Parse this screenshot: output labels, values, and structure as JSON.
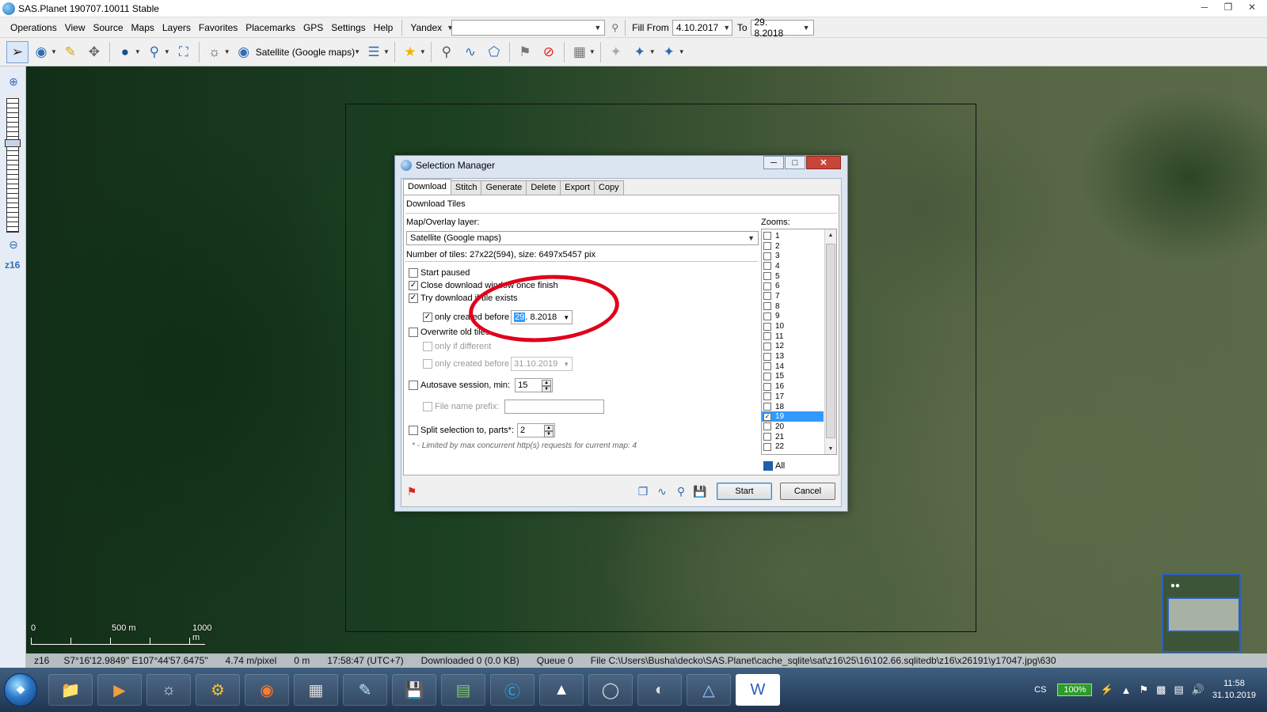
{
  "app": {
    "title": "SAS.Planet 190707.10011 Stable"
  },
  "menubar": {
    "items": [
      "Operations",
      "View",
      "Source",
      "Maps",
      "Layers",
      "Favorites",
      "Placemarks",
      "GPS",
      "Settings",
      "Help"
    ],
    "search_provider": "Yandex",
    "search_value": "",
    "fill_from_label": "Fill From",
    "fill_from_value": "4.10.2017",
    "to_label": "To",
    "to_value": "29.  8.2018"
  },
  "toolbar": {
    "map_source": "Satellite (Google maps)"
  },
  "map": {
    "zoom_label": "z16",
    "scale_labels": [
      "0",
      "500 m",
      "1000 m"
    ]
  },
  "statusbar": {
    "zoom": "z16",
    "coords": "S7°16'12.9849\" E107°44'57.6475\"",
    "resolution": "4.74 m/pixel",
    "altitude": "0 m",
    "time": "17:58:47 (UTC+7)",
    "downloaded": "Downloaded 0 (0.0 KB)",
    "queue": "Queue 0",
    "file": "File C:\\Users\\Busha\\decko\\SAS.Planet\\cache_sqlite\\sat\\z16\\25\\16\\102.66.sqlitedb\\z16\\x26191\\y17047.jpg\\630"
  },
  "dialog": {
    "title": "Selection Manager",
    "tabs": [
      "Download",
      "Stitch",
      "Generate",
      "Delete",
      "Export",
      "Copy"
    ],
    "heading": "Download Tiles",
    "layer_label": "Map/Overlay layer:",
    "layer_value": "Satellite (Google maps)",
    "tiles_info": "Number of tiles: 27x22(594), size: 6497x5457 pix",
    "start_paused": "Start paused",
    "close_window": "Close download window once finish",
    "try_download": "Try download if tile exists",
    "only_created_before": "only created before",
    "created_before_date_highlight": "29",
    "created_before_date_rest": ".  8.2018",
    "overwrite_old": "Overwrite old tiles",
    "only_if_different": "only if different",
    "only_created_before_2": "only created before",
    "created_before_date_2": "31.10.2019",
    "autosave_label": "Autosave session, min:",
    "autosave_value": "15",
    "file_prefix_label": "File name prefix:",
    "file_prefix_value": "",
    "split_label": "Split selection to, parts*:",
    "split_value": "2",
    "footnote": "* - Limited by max concurrent http(s) requests for current map: 4",
    "zooms_label": "Zooms:",
    "zooms": [
      "1",
      "2",
      "3",
      "4",
      "5",
      "6",
      "7",
      "8",
      "9",
      "10",
      "11",
      "12",
      "13",
      "14",
      "15",
      "16",
      "17",
      "18",
      "19",
      "20",
      "21",
      "22"
    ],
    "zoom_checked": "19",
    "all_label": "All",
    "start_button": "Start",
    "cancel_button": "Cancel"
  },
  "taskbar": {
    "language": "CS",
    "battery": "100%",
    "time": "11:58",
    "date": "31.10.2019"
  },
  "colors": {
    "annotation_ellipse": "#e0001a",
    "selection_blue": "#3399ff"
  }
}
